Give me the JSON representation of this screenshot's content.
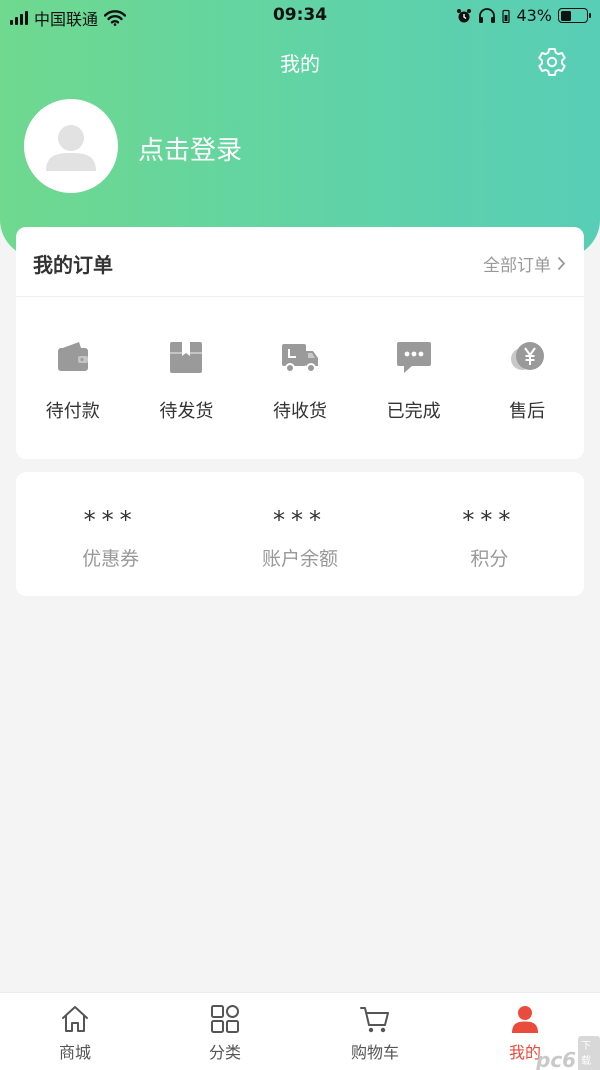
{
  "status_bar": {
    "carrier": "中国联通",
    "time": "09:34",
    "battery": "43%",
    "battery_level": 0.43
  },
  "header": {
    "title": "我的"
  },
  "profile": {
    "login_label": "点击登录"
  },
  "orders": {
    "title": "我的订单",
    "all_label": "全部订单",
    "items": [
      {
        "label": "待付款",
        "icon": "wallet-icon"
      },
      {
        "label": "待发货",
        "icon": "box-icon"
      },
      {
        "label": "待收货",
        "icon": "truck-icon"
      },
      {
        "label": "已完成",
        "icon": "chat-bubble-icon"
      },
      {
        "label": "售后",
        "icon": "yen-coin-icon"
      }
    ]
  },
  "assets": [
    {
      "value": "***",
      "label": "优惠券"
    },
    {
      "value": "***",
      "label": "账户余额"
    },
    {
      "value": "***",
      "label": "积分"
    }
  ],
  "tabbar": {
    "items": [
      {
        "label": "商城",
        "icon": "home-icon"
      },
      {
        "label": "分类",
        "icon": "grid-icon"
      },
      {
        "label": "购物车",
        "icon": "cart-icon"
      },
      {
        "label": "我的",
        "icon": "person-icon",
        "active": true
      }
    ]
  },
  "watermark": {
    "text": "pc6",
    "badge": "下载站"
  },
  "colors": {
    "gradient_start": "#6fd98f",
    "gradient_end": "#58ceb6",
    "active_tab": "#e94b3c",
    "icon_gray": "#999999"
  }
}
